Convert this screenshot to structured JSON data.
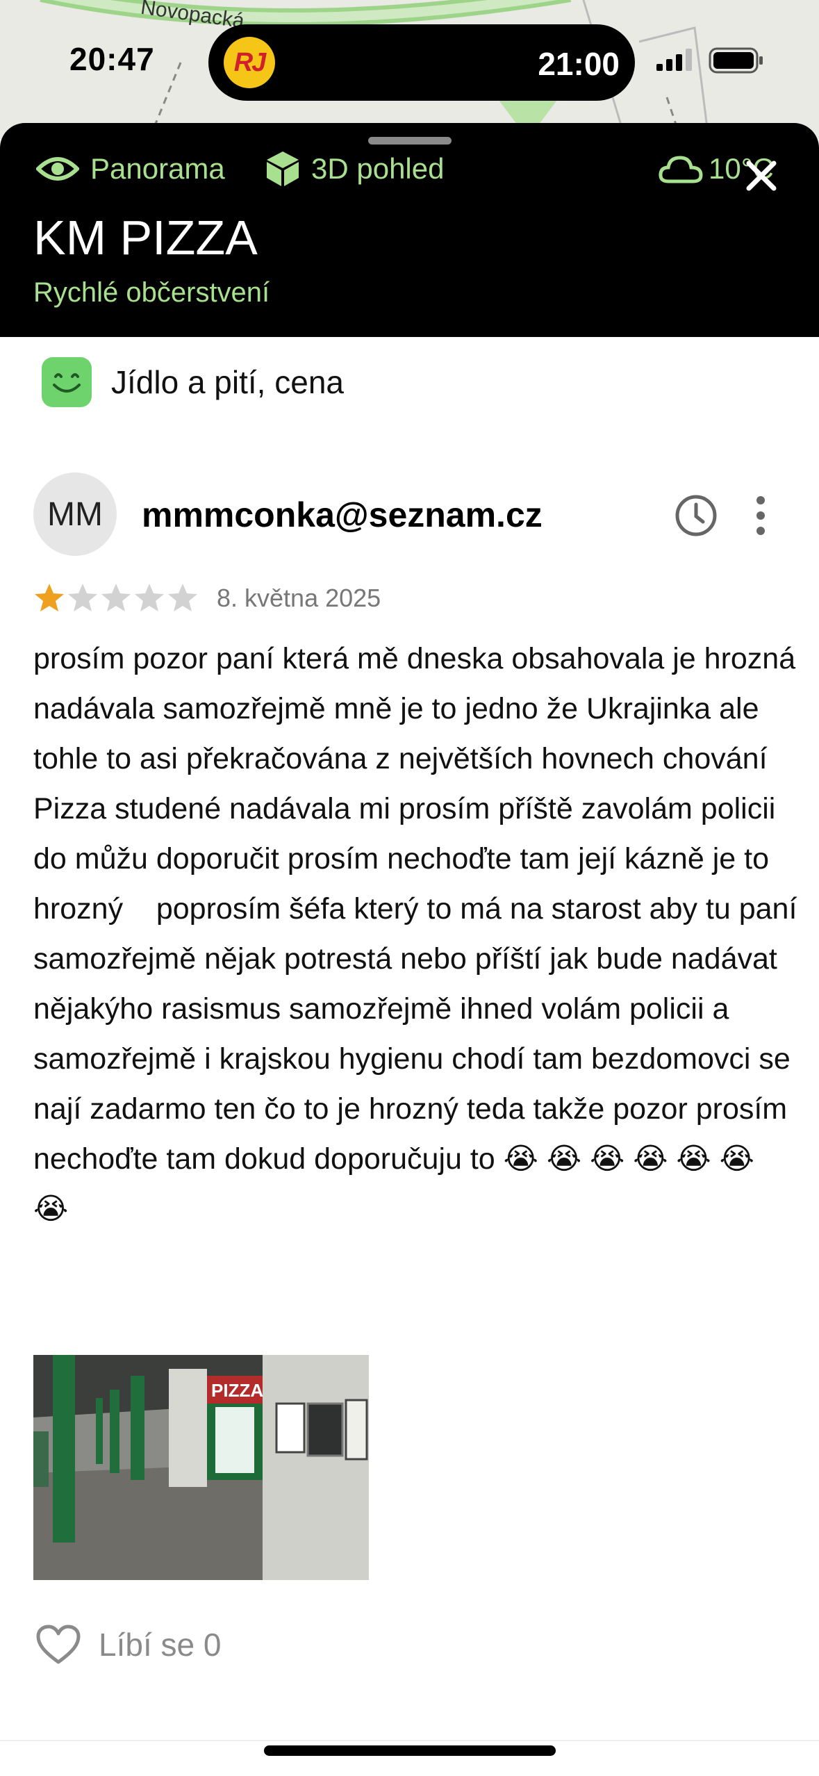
{
  "status_bar": {
    "time": "20:47",
    "island_badge": "RJ",
    "island_time": "21:00"
  },
  "map": {
    "street_label": "Novopacká"
  },
  "header": {
    "panorama_label": "Panorama",
    "view3d_label": "3D pohled",
    "weather_temp": "10°C",
    "title": "KM PIZZA",
    "category": "Rychlé občerstvení"
  },
  "attribute": {
    "label": "Jídlo a pití, cena"
  },
  "review": {
    "avatar_initials": "MM",
    "author": "mmmconka@seznam.cz",
    "rating": 1,
    "max_rating": 5,
    "date": "8. května 2025",
    "text": "prosím pozor paní která mě dneska obsahovala je hrozná nadávala samozřejmě mně je to jedno že Ukrajinka ale tohle to asi překračována z největších hovnech chování Pizza studené nadávala mi prosím příště zavolám policii do můžu doporučit prosím nechoďte tam její kázně je to hrozný    poprosím šéfa který to má na starost aby tu paní samozřejmě nějak potrestá nebo příští jak bude nadávat nějakýho rasismus samozřejmě ihned volám policii a samozřejmě i krajskou hygienu chodí tam bezdomovci se nají zadarmo ten čo to je hrozný teda takže pozor prosím nechoďte tam dokud doporučuju to 😭 😭 😭 😭 😭 😭 😭",
    "photo_sign": "PIZZA",
    "like_label": "Líbí se 0"
  },
  "colors": {
    "accent_green": "#a8e08f",
    "star_filled": "#f0a021",
    "star_empty": "#d2d2d2"
  }
}
